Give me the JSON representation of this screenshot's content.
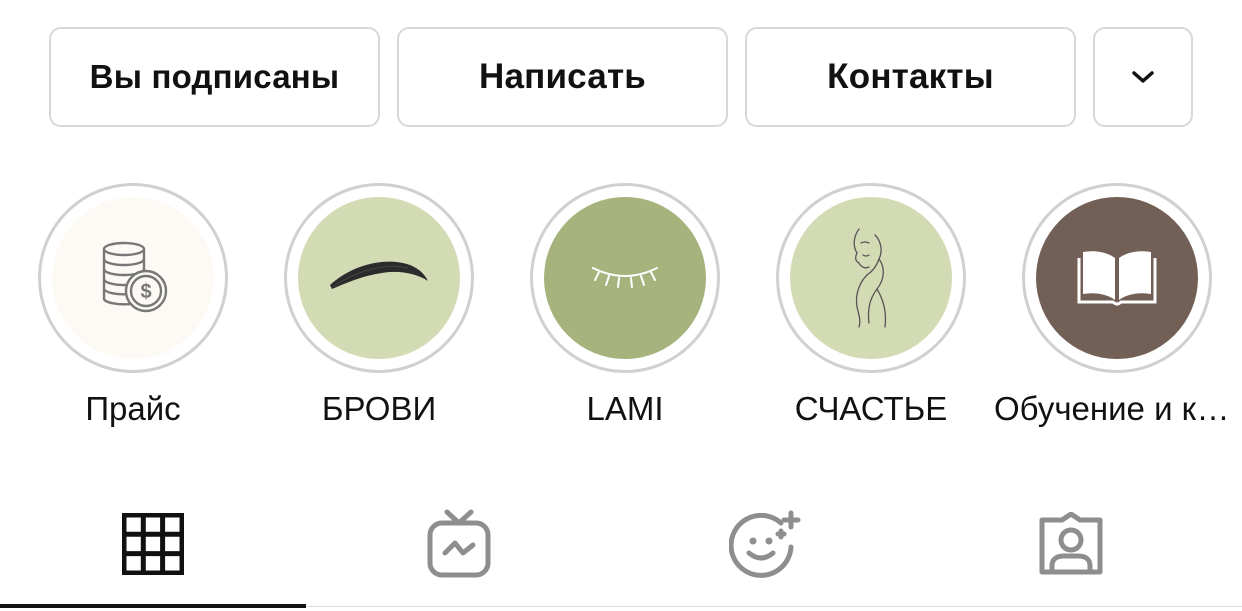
{
  "actions": {
    "following_label": "Вы подписаны",
    "message_label": "Написать",
    "contacts_label": "Контакты",
    "more_icon": "chevron-down-icon"
  },
  "highlights": [
    {
      "label": "Прайс",
      "icon": "coins-dollar-icon",
      "cover_color": "#fdfaf5"
    },
    {
      "label": "БРОВИ",
      "icon": "eyebrow-icon",
      "cover_color": "#d3dbb5"
    },
    {
      "label": "LAMI",
      "icon": "closed-eye-lashes-icon",
      "cover_color": "#a7b37d"
    },
    {
      "label": "СЧАСТЬЕ",
      "icon": "face-line-art-icon",
      "cover_color": "#d3dbb5"
    },
    {
      "label": "Обучение и консультации",
      "icon": "open-book-icon",
      "cover_color": "#725f55"
    }
  ],
  "tabs": [
    {
      "id": "grid",
      "icon": "grid-icon",
      "active": true
    },
    {
      "id": "igtv",
      "icon": "igtv-icon",
      "active": false
    },
    {
      "id": "effects",
      "icon": "face-effects-icon",
      "active": false
    },
    {
      "id": "tagged",
      "icon": "tagged-user-icon",
      "active": false
    }
  ],
  "colors": {
    "border": "#d8d8d8",
    "text": "#111111",
    "inactive_icon": "#8e8e8e"
  }
}
